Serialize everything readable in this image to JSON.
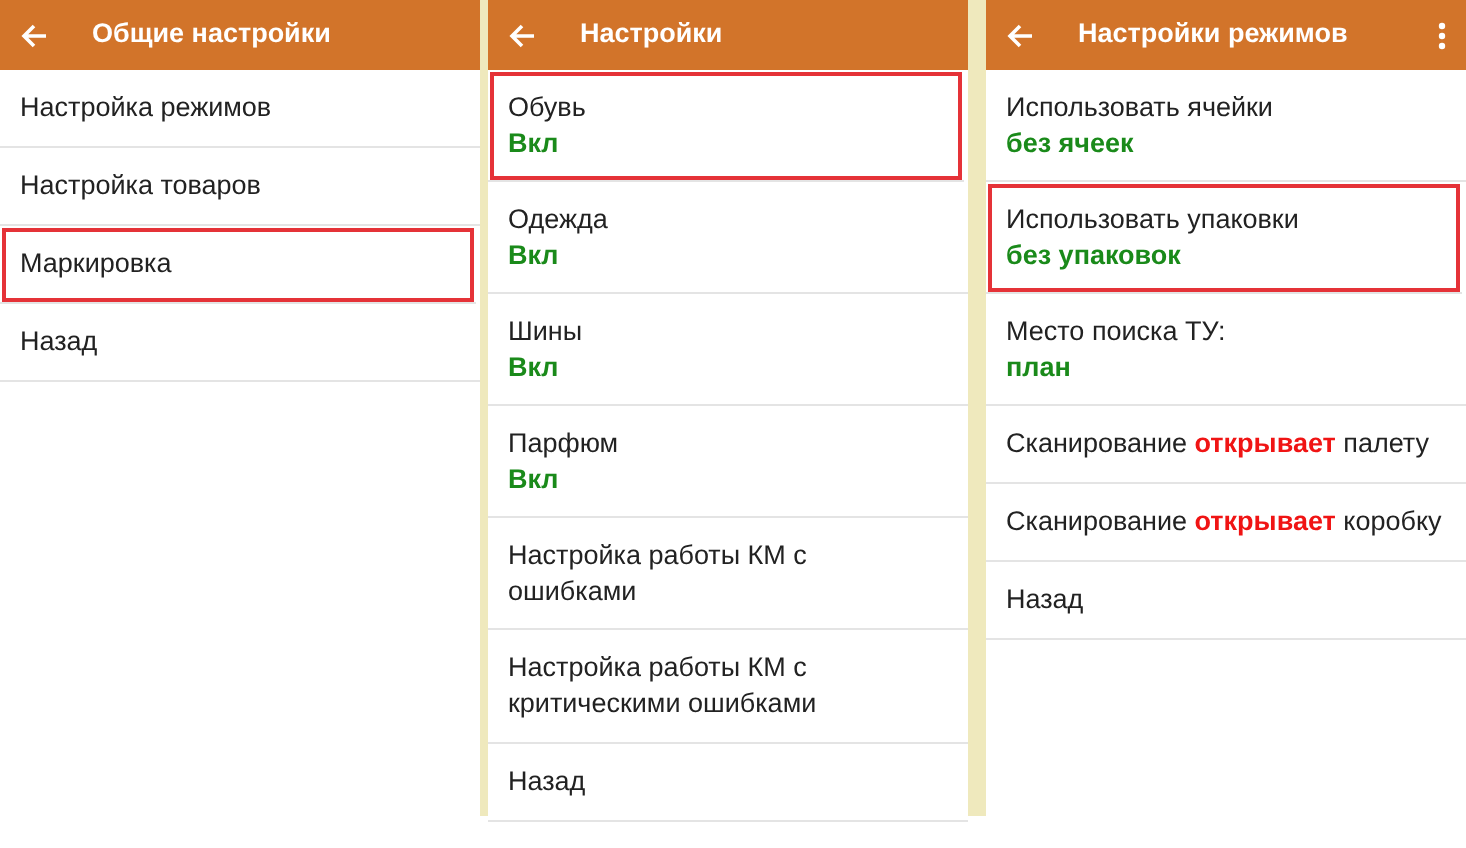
{
  "screens": [
    {
      "title": "Общие настройки",
      "has_menu": false,
      "items": [
        {
          "label": "Настройка режимов",
          "highlighted": false
        },
        {
          "label": "Настройка товаров",
          "highlighted": false
        },
        {
          "label": "Маркировка",
          "highlighted": true
        },
        {
          "label": "Назад",
          "highlighted": false
        }
      ]
    },
    {
      "title": "Настройки",
      "has_menu": false,
      "items": [
        {
          "label": "Обувь",
          "value": "Вкл",
          "highlighted": true
        },
        {
          "label": "Одежда",
          "value": "Вкл",
          "highlighted": false
        },
        {
          "label": "Шины",
          "value": "Вкл",
          "highlighted": false
        },
        {
          "label": "Парфюм",
          "value": "Вкл",
          "highlighted": false
        },
        {
          "label": "Настройка работы КМ с ошибками",
          "highlighted": false
        },
        {
          "label": "Настройка работы КМ с критическими ошибками",
          "highlighted": false
        },
        {
          "label": "Назад",
          "highlighted": false
        }
      ]
    },
    {
      "title": "Настройки режимов",
      "has_menu": true,
      "items": [
        {
          "label": "Использовать ячейки",
          "value": "без ячеек",
          "highlighted": false
        },
        {
          "label": "Использовать упаковки",
          "value": "без упаковок",
          "highlighted": true
        },
        {
          "label": "Место поиска ТУ:",
          "value": "план",
          "highlighted": false
        },
        {
          "label": "Сканирование **открывает** палету",
          "highlighted": false
        },
        {
          "label": "Сканирование **открывает** коробку",
          "highlighted": false
        },
        {
          "label": "Назад",
          "highlighted": false
        }
      ]
    }
  ]
}
